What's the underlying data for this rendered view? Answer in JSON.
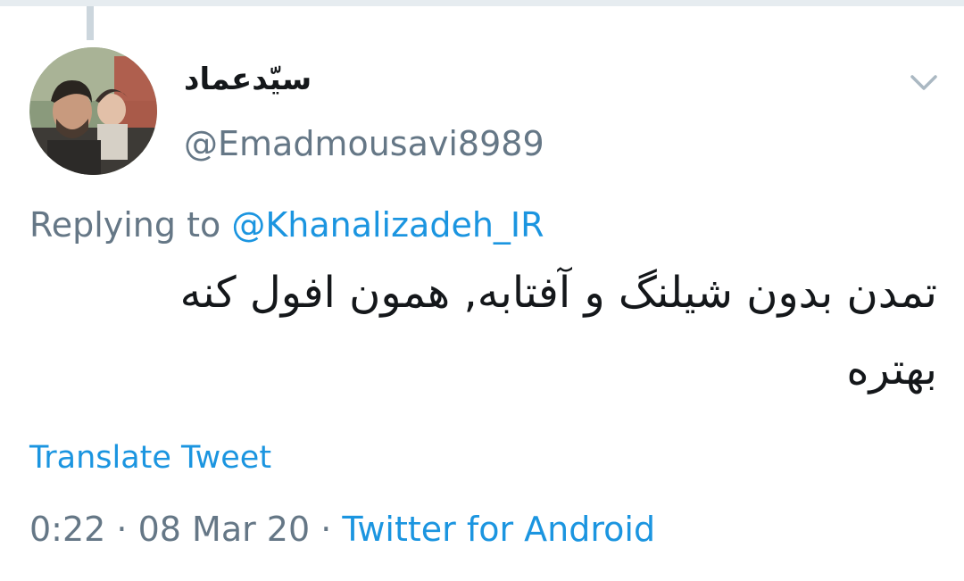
{
  "tweet": {
    "display_name": "سیّدعماد",
    "handle": "@Emadmousavi8989",
    "replying_prefix": "Replying to",
    "reply_to_handle": "@Khanalizadeh_IR",
    "text": "تمدن بدون شیلنگ و آفتابه, همون افول کنه بهتره",
    "translate_label": "Translate Tweet",
    "time": "0:22",
    "separator": " · ",
    "date": "08 Mar 20",
    "source": "Twitter for Android"
  },
  "colors": {
    "link": "#1b95e0",
    "secondary_text": "#657786",
    "primary_text": "#14171a",
    "thread_line": "#ccd6dd"
  },
  "icons": {
    "menu": "chevron-down-icon",
    "avatar": "profile-avatar"
  }
}
